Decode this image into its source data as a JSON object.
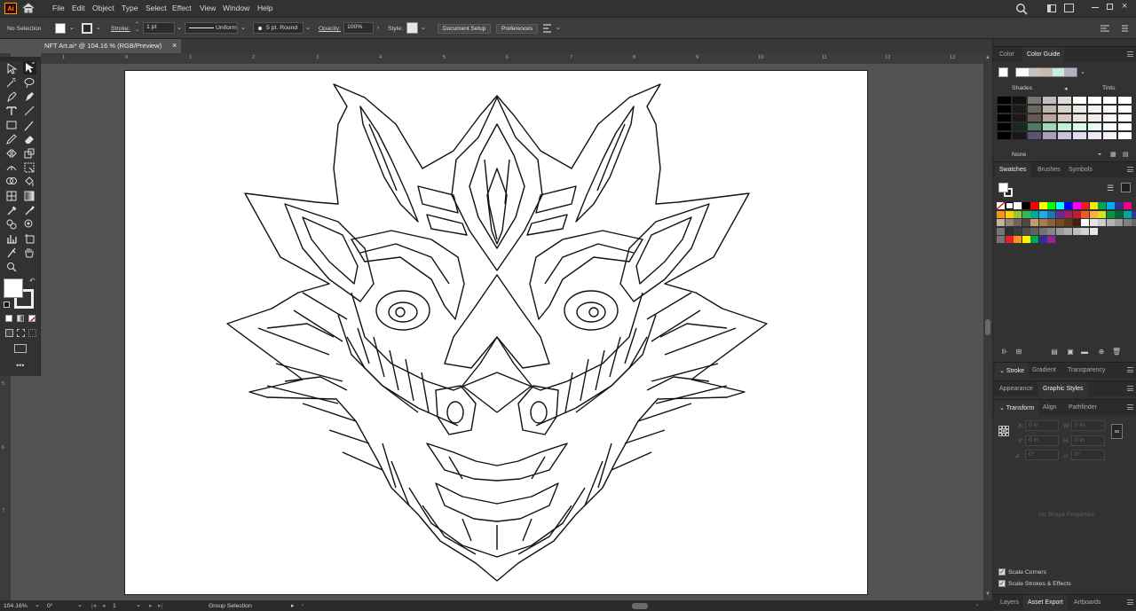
{
  "app": {
    "logo": "Ai"
  },
  "menu": [
    "File",
    "Edit",
    "Object",
    "Type",
    "Select",
    "Effect",
    "View",
    "Window",
    "Help"
  ],
  "control_bar": {
    "selection": "No Selection",
    "stroke_label": "Stroke:",
    "stroke_value": "1 pt",
    "profile": "Uniform",
    "brush": "5 pt. Round",
    "opacity_label": "Opacity:",
    "opacity_value": "100%",
    "style_label": "Style:",
    "doc_setup": "Document Setup",
    "preferences": "Preferences"
  },
  "document_tab": {
    "title": "NFT Art.ai* @ 104.16 % (RGB/Preview)",
    "close": "×"
  },
  "ruler_h": [
    "1",
    "0",
    "1",
    "2",
    "3",
    "4",
    "5",
    "6",
    "7",
    "8",
    "9",
    "10",
    "11",
    "12",
    "13"
  ],
  "ruler_v": [
    "5",
    "6",
    "7"
  ],
  "panels": {
    "color_tabs": [
      "Color",
      "Color Guide"
    ],
    "shades_label": "Shades",
    "tints_label": "Tints",
    "none_label": "None",
    "swatch_tabs": [
      "Swatches",
      "Brushes",
      "Symbols"
    ],
    "stroke_tabs": [
      "Stroke",
      "Gradient",
      "Transparency"
    ],
    "appearance_tabs": [
      "Appearance",
      "Graphic Styles"
    ],
    "transform_tabs": [
      "Transform",
      "Align",
      "Pathfinder"
    ],
    "transform_fields": {
      "x_label": "X:",
      "x_value": "0 in",
      "y_label": "Y:",
      "y_value": "0 in",
      "w_label": "W:",
      "w_value": "0 in",
      "h_label": "H:",
      "h_value": "0 in",
      "angle": "0°",
      "shear": "0°"
    },
    "no_shape": "No Shape Properties",
    "scale_corners": "Scale Corners",
    "scale_strokes": "Scale Strokes & Effects",
    "bottom_tabs": [
      "Layers",
      "Asset Export",
      "Artboards"
    ]
  },
  "status": {
    "zoom": "104.16%",
    "rotation": "0°",
    "artboard": "1",
    "tool": "Group Selection"
  },
  "colors": {
    "accent": "#3a78d0",
    "icon_badge": "#ff9a00",
    "artwork_stroke": "#111111"
  },
  "swatch_colors": {
    "row1": [
      "#ff0000",
      "#ffff00",
      "#00ff00",
      "#00ffff",
      "#0000ff",
      "#ff00ff",
      "#ed1c24",
      "#ffe600",
      "#00a651",
      "#00aeef",
      "#2e3192",
      "#ec008c",
      "#f7941d",
      "#ffcf00",
      "#8dc63f",
      "#39b54a",
      "#00a99d",
      "#27aae1",
      "#1c75bc",
      "#662d91",
      "#9e1f63",
      "#be1e2d",
      "#f15a24",
      "#fbb040",
      "#d7df23",
      "#009444",
      "#006838",
      "#00a79d",
      "#2b3990",
      "#92278f"
    ],
    "row2": [
      "#c2b59b",
      "#998675",
      "#736357",
      "#534741",
      "#c69c6d",
      "#a67c52",
      "#8c6239",
      "#754c24",
      "#603913",
      "#42210b",
      "#ffffff",
      "#e6e6e6",
      "#cccccc",
      "#b3b3b3",
      "#999999",
      "#808080",
      "#666666",
      "#4d4d4d",
      "#333333",
      "#1a1a1a",
      "#000000"
    ],
    "grays": [
      "#2f2f2f",
      "#3d3d3d",
      "#4f4f4f",
      "#616161",
      "#747474",
      "#878787",
      "#9a9a9a",
      "#adadad",
      "#c0c0c0",
      "#d3d3d3",
      "#e6e6e6"
    ],
    "brights": [
      "#ed1c24",
      "#f7941d",
      "#fff200",
      "#00a651",
      "#2e3192",
      "#92278f"
    ]
  }
}
